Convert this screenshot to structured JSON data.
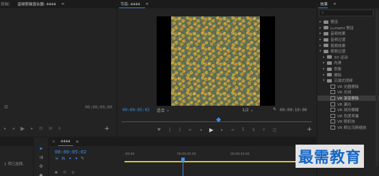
{
  "source": {
    "tabs": [
      "剪辑）",
      "音频剪辑混合器: 4444"
    ],
    "menu_glyph": "≡",
    "timecode_right": "00;00;00;00",
    "timecode_left": "",
    "add_label": "+"
  },
  "program": {
    "title": "节目: 4444",
    "menu_glyph": "≡",
    "timecode_current": "00:00:05:02",
    "fit_label": "适合",
    "resolution": "1/2",
    "timecode_duration": "00:00:10:00",
    "add_label": "+"
  },
  "effects": {
    "title": "效果",
    "menu_glyph": "≡",
    "search_placeholder": "",
    "items": [
      {
        "label": "预设",
        "depth": 0,
        "kind": "folder",
        "expanded": false
      },
      {
        "label": "Lumetri 预设",
        "depth": 0,
        "kind": "folder",
        "expanded": false
      },
      {
        "label": "音频效果",
        "depth": 0,
        "kind": "folder",
        "expanded": false
      },
      {
        "label": "音频过渡",
        "depth": 0,
        "kind": "folder",
        "expanded": false
      },
      {
        "label": "视频效果",
        "depth": 0,
        "kind": "folder",
        "expanded": false
      },
      {
        "label": "视频过渡",
        "depth": 0,
        "kind": "folder",
        "expanded": true
      },
      {
        "label": "3D 运动",
        "depth": 1,
        "kind": "folder",
        "expanded": false
      },
      {
        "label": "内滑",
        "depth": 1,
        "kind": "folder",
        "expanded": false
      },
      {
        "label": "划像",
        "depth": 1,
        "kind": "folder",
        "expanded": false
      },
      {
        "label": "擦除",
        "depth": 1,
        "kind": "folder",
        "expanded": false
      },
      {
        "label": "沉浸式视频",
        "depth": 1,
        "kind": "folder",
        "expanded": true
      },
      {
        "label": "VR 光圈擦除",
        "depth": 2,
        "kind": "fx"
      },
      {
        "label": "VR 光线",
        "depth": 2,
        "kind": "fx"
      },
      {
        "label": "VR 渐变擦除",
        "depth": 2,
        "kind": "fx",
        "selected": true
      },
      {
        "label": "VR 漏光",
        "depth": 2,
        "kind": "fx"
      },
      {
        "label": "VR 球形模糊",
        "depth": 2,
        "kind": "fx"
      },
      {
        "label": "VR 色度泄漏",
        "depth": 2,
        "kind": "fx"
      },
      {
        "label": "VR 随机块",
        "depth": 2,
        "kind": "fx"
      },
      {
        "label": "VR 默比乌斯缩放",
        "depth": 2,
        "kind": "fx"
      }
    ]
  },
  "project": {
    "status": "1 项已选择,"
  },
  "timeline": {
    "close_glyph": "×",
    "title": "4444",
    "menu_glyph": "≡",
    "timecode": "00:00:05:02",
    "ruler": [
      ":00:00",
      "00:00:05:00",
      "00:00:10:00"
    ],
    "playhead_fraction": 0.5
  },
  "watermark": {
    "text": "最需教育"
  },
  "colors": {
    "accent": "#3f8fe6",
    "inout_bar": "#d8c63a",
    "watermark": "#1566c7"
  }
}
